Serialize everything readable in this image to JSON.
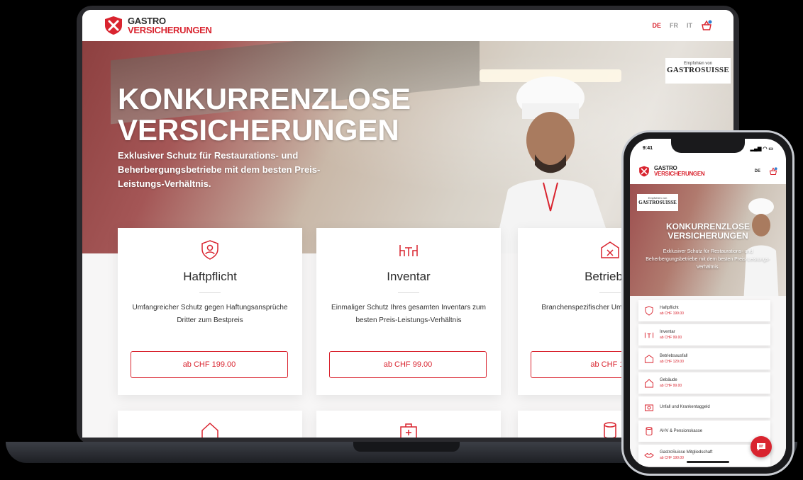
{
  "brand": {
    "line1": "GASTRO",
    "line2": "VERSICHERUNGEN",
    "accent": "#d9242f"
  },
  "languages": [
    "DE",
    "FR",
    "IT"
  ],
  "active_language": "DE",
  "badge": {
    "top": "Empfohlen von",
    "name": "GASTROSUISSE"
  },
  "hero": {
    "title_line1": "KONKURRENZLOSE",
    "title_line2": "VERSICHERUNGEN",
    "subtitle": "Exklusiver Schutz für Restaurations- und Beherbergungsbetriebe mit dem besten Preis-Leistungs-Verhältnis."
  },
  "cards": [
    {
      "icon": "person-shield-icon",
      "title": "Haftpflicht",
      "desc": "Umfangreicher Schutz gegen Haftungsansprüche Dritter zum Bestpreis",
      "button": "ab CHF 199.00"
    },
    {
      "icon": "table-chairs-icon",
      "title": "Inventar",
      "desc": "Einmaliger Schutz Ihres gesamten Inventars zum besten Preis-Leistungs-Verhältnis",
      "button": "ab CHF 99.00"
    },
    {
      "icon": "closed-sign-icon",
      "title": "Betriebsa",
      "desc": "Branchenspezifischer Umsatzausfälle zu To",
      "button": "ab CHF 12"
    }
  ],
  "phone": {
    "time": "9:41",
    "lang": "DE",
    "title_line1": "KONKURRENZLOSE",
    "title_line2": "VERSICHERUNGEN",
    "subtitle": "Exklusiver Schutz für Restaurations- und Beherbergungsbetriebe mit dem besten Preis-Leistungs-Verhältnis.",
    "items": [
      {
        "name": "Haftpflicht",
        "price": "ab CHF 199.00"
      },
      {
        "name": "Inventar",
        "price": "ab CHF 99.00"
      },
      {
        "name": "Betriebsausfall",
        "price": "ab CHF 129.00"
      },
      {
        "name": "Gebäude",
        "price": "ab CHF 99.00"
      },
      {
        "name": "Unfall und Krankentaggeld",
        "price": ""
      },
      {
        "name": "AHV & Pensionskasse",
        "price": ""
      },
      {
        "name": "GastroSuisse Mitgliedschaft",
        "price": "ab CHF 190.00"
      }
    ]
  }
}
